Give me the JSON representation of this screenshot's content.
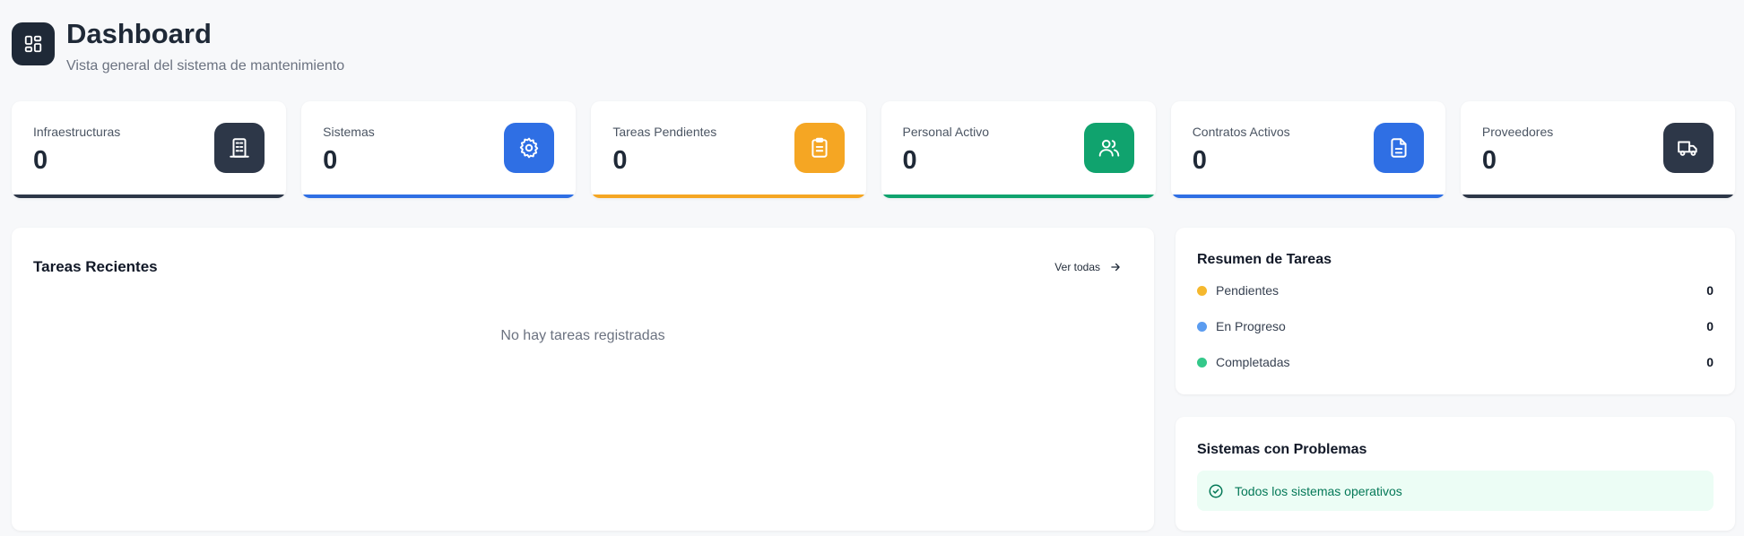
{
  "header": {
    "title": "Dashboard",
    "subtitle": "Vista general del sistema de mantenimiento",
    "icon": "dashboard-grid-icon"
  },
  "stats": [
    {
      "label": "Infraestructuras",
      "value": "0",
      "icon": "building-icon",
      "color": "#2d3748"
    },
    {
      "label": "Sistemas",
      "value": "0",
      "icon": "gear-icon",
      "color": "#2f6fe4"
    },
    {
      "label": "Tareas Pendientes",
      "value": "0",
      "icon": "clipboard-icon",
      "color": "#f5a623"
    },
    {
      "label": "Personal Activo",
      "value": "0",
      "icon": "users-icon",
      "color": "#10a36e"
    },
    {
      "label": "Contratos Activos",
      "value": "0",
      "icon": "document-icon",
      "color": "#2f6fe4"
    },
    {
      "label": "Proveedores",
      "value": "0",
      "icon": "truck-icon",
      "color": "#2d3748"
    }
  ],
  "recent_tasks": {
    "title": "Tareas Recientes",
    "view_all": "Ver todas",
    "empty": "No hay tareas registradas"
  },
  "summary": {
    "title": "Resumen de Tareas",
    "items": [
      {
        "label": "Pendientes",
        "count": "0",
        "color": "#f5b82e"
      },
      {
        "label": "En Progreso",
        "count": "0",
        "color": "#5b9cf0"
      },
      {
        "label": "Completadas",
        "count": "0",
        "color": "#34c88a"
      }
    ]
  },
  "problems": {
    "title": "Sistemas con Problemas",
    "status": "Todos los sistemas operativos"
  }
}
